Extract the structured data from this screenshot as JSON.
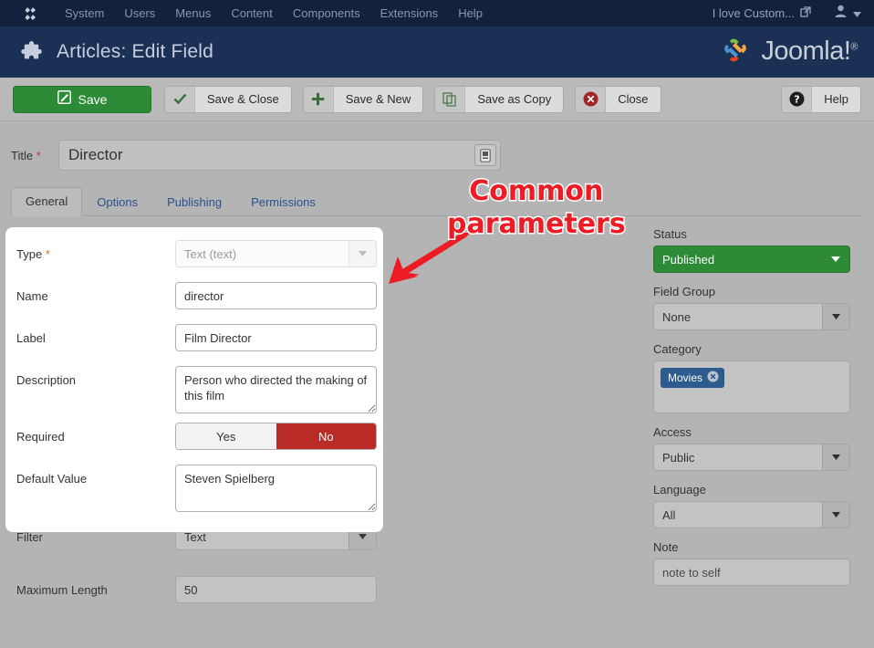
{
  "topbar": {
    "logo_icon": "joomla-mark-icon",
    "menu": [
      {
        "label": "System"
      },
      {
        "label": "Users"
      },
      {
        "label": "Menus"
      },
      {
        "label": "Content"
      },
      {
        "label": "Components"
      },
      {
        "label": "Extensions"
      },
      {
        "label": "Help"
      }
    ],
    "site_link": "I love Custom...",
    "site_link_icon": "external-link-icon",
    "user_icon": "user-icon",
    "user_caret_icon": "caret-down-icon"
  },
  "subhead": {
    "icon": "puzzle-piece-icon",
    "title": "Articles: Edit Field",
    "brand": "Joomla!",
    "brand_reg": "®"
  },
  "toolbar": {
    "save": {
      "label": "Save",
      "icon": "pencil-square-icon"
    },
    "save_close": {
      "label": "Save & Close",
      "icon": "check-icon"
    },
    "save_new": {
      "label": "Save & New",
      "icon": "plus-icon"
    },
    "save_copy": {
      "label": "Save as Copy",
      "icon": "copy-icon"
    },
    "close": {
      "label": "Close",
      "icon": "circle-x-icon"
    },
    "help": {
      "label": "Help",
      "icon": "circle-question-icon"
    }
  },
  "title_field": {
    "label": "Title",
    "required_mark": "*",
    "value": "Director",
    "editor_toggle_icon": "editor-toggle-icon"
  },
  "tabs": [
    {
      "label": "General",
      "active": true
    },
    {
      "label": "Options",
      "active": false
    },
    {
      "label": "Publishing",
      "active": false
    },
    {
      "label": "Permissions",
      "active": false
    }
  ],
  "form": {
    "type": {
      "label": "Type",
      "required_mark": "*",
      "value": "Text (text)",
      "disabled": true
    },
    "name": {
      "label": "Name",
      "value": "director"
    },
    "field_label": {
      "label": "Label",
      "value": "Film Director"
    },
    "description": {
      "label": "Description",
      "value": "Person who directed the making of this film"
    },
    "required": {
      "label": "Required",
      "yes_label": "Yes",
      "no_label": "No",
      "selected": "No"
    },
    "default_value": {
      "label": "Default Value",
      "value": "Steven Spielberg"
    },
    "filter": {
      "label": "Filter",
      "value": "Text"
    },
    "maximum_length": {
      "label": "Maximum Length",
      "value": "50"
    }
  },
  "sidebar": {
    "status": {
      "label": "Status",
      "value": "Published"
    },
    "field_group": {
      "label": "Field Group",
      "value": "None"
    },
    "category": {
      "label": "Category",
      "chips": [
        {
          "label": "Movies",
          "remove_icon": "chip-remove-icon"
        }
      ]
    },
    "access": {
      "label": "Access",
      "value": "Public"
    },
    "language": {
      "label": "Language",
      "value": "All"
    },
    "note": {
      "label": "Note",
      "value": "note to self"
    }
  },
  "annotation": {
    "line1": "Common",
    "line2": "parameters",
    "color": "#ed1c24",
    "arrow_icon": "annotation-arrow-icon"
  }
}
